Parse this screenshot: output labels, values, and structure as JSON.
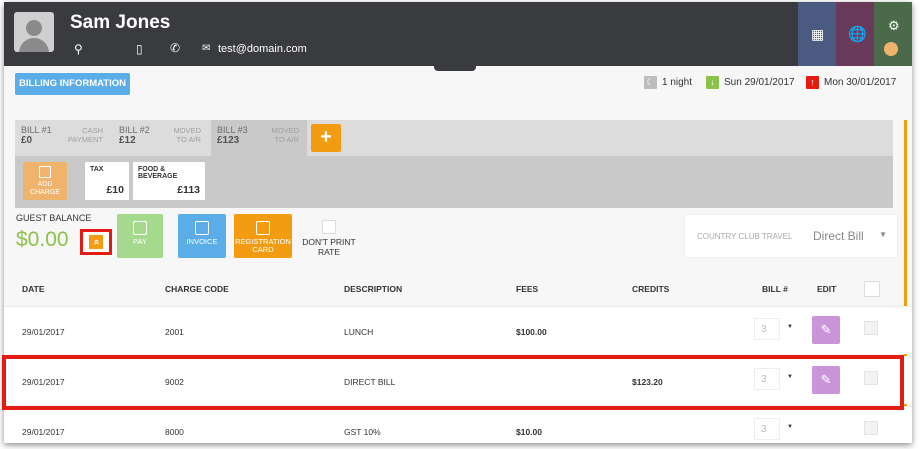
{
  "header": {
    "guest_name": "Sam Jones",
    "email": "test@domain.com",
    "icons": [
      "location-icon",
      "mobile-icon",
      "phone-icon",
      "email-icon"
    ],
    "side_icons": [
      "room-icon",
      "globe-icon",
      "tools-icon"
    ],
    "side_colors": [
      "#4a5a80",
      "#6a3a5a",
      "#4a6a4a"
    ]
  },
  "toolbar": {
    "billing_label": "BILLING INFORMATION",
    "nights": "1 night",
    "arrival": "Sun 29/01/2017",
    "departure": "Mon 30/01/2017"
  },
  "bills": [
    {
      "title": "BILL #1",
      "amount": "£0",
      "status": "CASH PAYMENT"
    },
    {
      "title": "BILL #2",
      "amount": "£12",
      "status": "MOVED TO A/R"
    },
    {
      "title": "BILL #3",
      "amount": "£123",
      "status": "MOVED TO A/R",
      "active": true
    }
  ],
  "add_bill_label": "+",
  "charges": {
    "add_label": "ADD CHARGE",
    "cards": [
      {
        "label": "TAX",
        "value": "£10"
      },
      {
        "label": "FOOD & BEVERAGE",
        "value": "£113"
      }
    ]
  },
  "balance": {
    "label": "GUEST BALANCE",
    "amount": "$0.00",
    "expand_glyph": "«"
  },
  "actions": {
    "pay": "PAY",
    "invoice": "INVOICE",
    "registration": "REGISTRATION CARD",
    "dont_print": "DON'T PRINT RATE",
    "colors": {
      "pay": "#a5d98d",
      "invoice": "#5aade6",
      "registration": "#f39c12"
    }
  },
  "direct_bill": {
    "company": "COUNTRY CLUB TRAVEL",
    "value": "Direct Bill"
  },
  "table": {
    "columns": [
      "DATE",
      "CHARGE CODE",
      "DESCRIPTION",
      "FEES",
      "CREDITS",
      "BILL #",
      "EDIT"
    ],
    "rows": [
      {
        "date": "29/01/2017",
        "code": "2001",
        "description": "LUNCH",
        "fees": "$100.00",
        "credits": "",
        "bill": "3"
      },
      {
        "date": "29/01/2017",
        "code": "9002",
        "description": "DIRECT BILL",
        "fees": "",
        "credits": "$123.20",
        "bill": "3"
      },
      {
        "date": "29/01/2017",
        "code": "8000",
        "description": "GST 10%",
        "fees": "$10.00",
        "credits": "",
        "bill": "3"
      }
    ]
  },
  "colors": {
    "header_bg": "#3a3b3e",
    "accent_orange": "#f39c12",
    "highlight_red": "#e41b13",
    "balance_green": "#8bc34a",
    "edit_purple": "#c995d8"
  }
}
